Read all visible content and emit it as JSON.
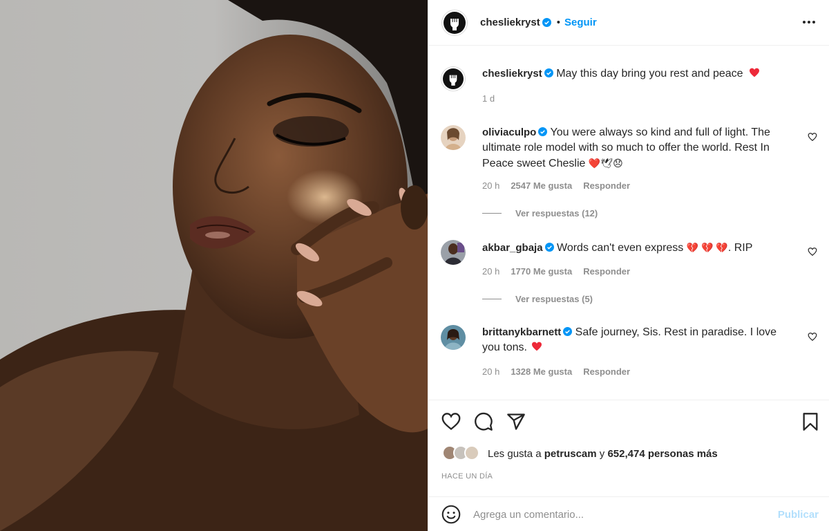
{
  "post": {
    "author": "chesliekryst",
    "follow_label": "Seguir",
    "separator": "•",
    "caption": "May this day bring you rest and peace",
    "caption_time": "1 d"
  },
  "comments": [
    {
      "username": "oliviaculpo",
      "text": "You were always so kind and full of light. The ultimate role model with so much to offer the world. Rest In Peace sweet Cheslie",
      "emoji": "❤️🕊😞",
      "time": "20 h",
      "likes": "2547 Me gusta",
      "reply_label": "Responder",
      "view_replies": "Ver respuestas (12)"
    },
    {
      "username": "akbar_gbaja",
      "text": "Words can't even express",
      "emoji": "💔 💔 💔",
      "suffix": ". RIP",
      "time": "20 h",
      "likes": "1770 Me gusta",
      "reply_label": "Responder",
      "view_replies": "Ver respuestas (5)"
    },
    {
      "username": "brittanykbarnett",
      "text": "Safe journey, Sis. Rest in paradise. I love you tons.",
      "emoji": "❤️",
      "time": "20 h",
      "likes": "1328 Me gusta",
      "reply_label": "Responder"
    }
  ],
  "likes": {
    "prefix": "Les gusta a",
    "user": "petruscam",
    "middle": "y",
    "count": "652,474 personas más"
  },
  "timestamp": "HACE UN DÍA",
  "comment_box": {
    "placeholder": "Agrega un comentario...",
    "publish_label": "Publicar"
  },
  "colors": {
    "accent": "#0095f6",
    "heart": "#ed4956",
    "muted": "#8e8e8e"
  }
}
